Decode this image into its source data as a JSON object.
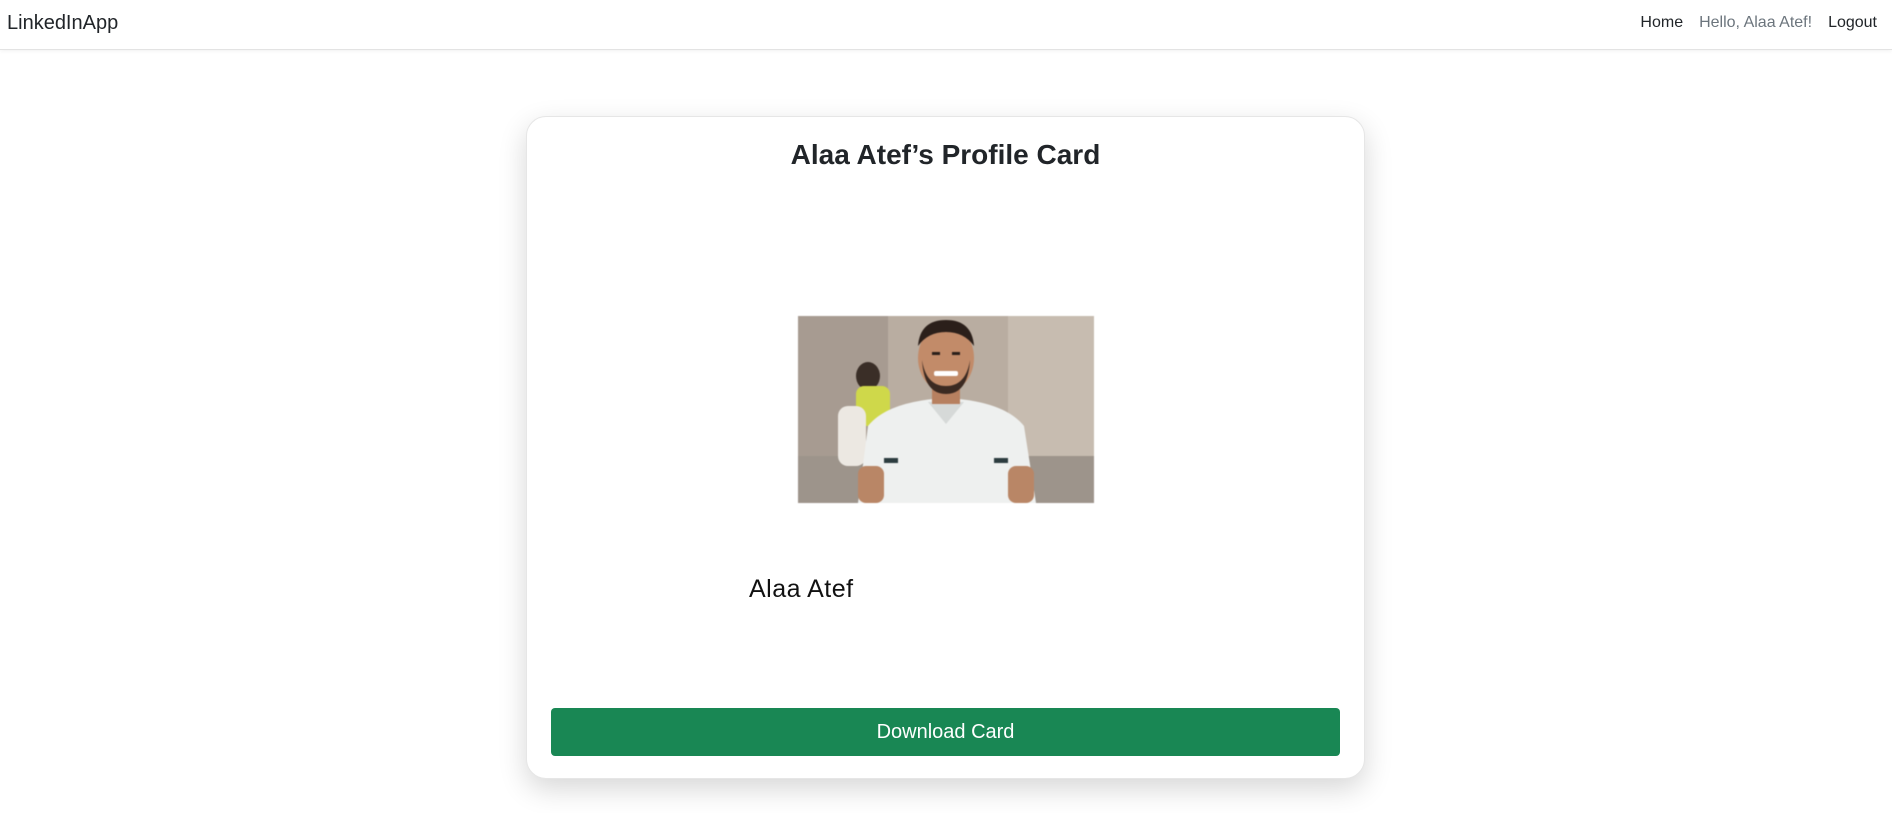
{
  "navbar": {
    "brand": "LinkedInApp",
    "links": {
      "home": "Home",
      "greeting": "Hello, Alaa Atef!",
      "logout": "Logout"
    }
  },
  "card": {
    "title": "Alaa Atef’s Profile Card",
    "photo": {
      "icon": "profile-photo"
    },
    "name": "Alaa Atef",
    "download_label": "Download Card"
  },
  "colors": {
    "button_bg": "#198754",
    "button_text": "#ffffff",
    "greeting_text": "#6c757d"
  }
}
